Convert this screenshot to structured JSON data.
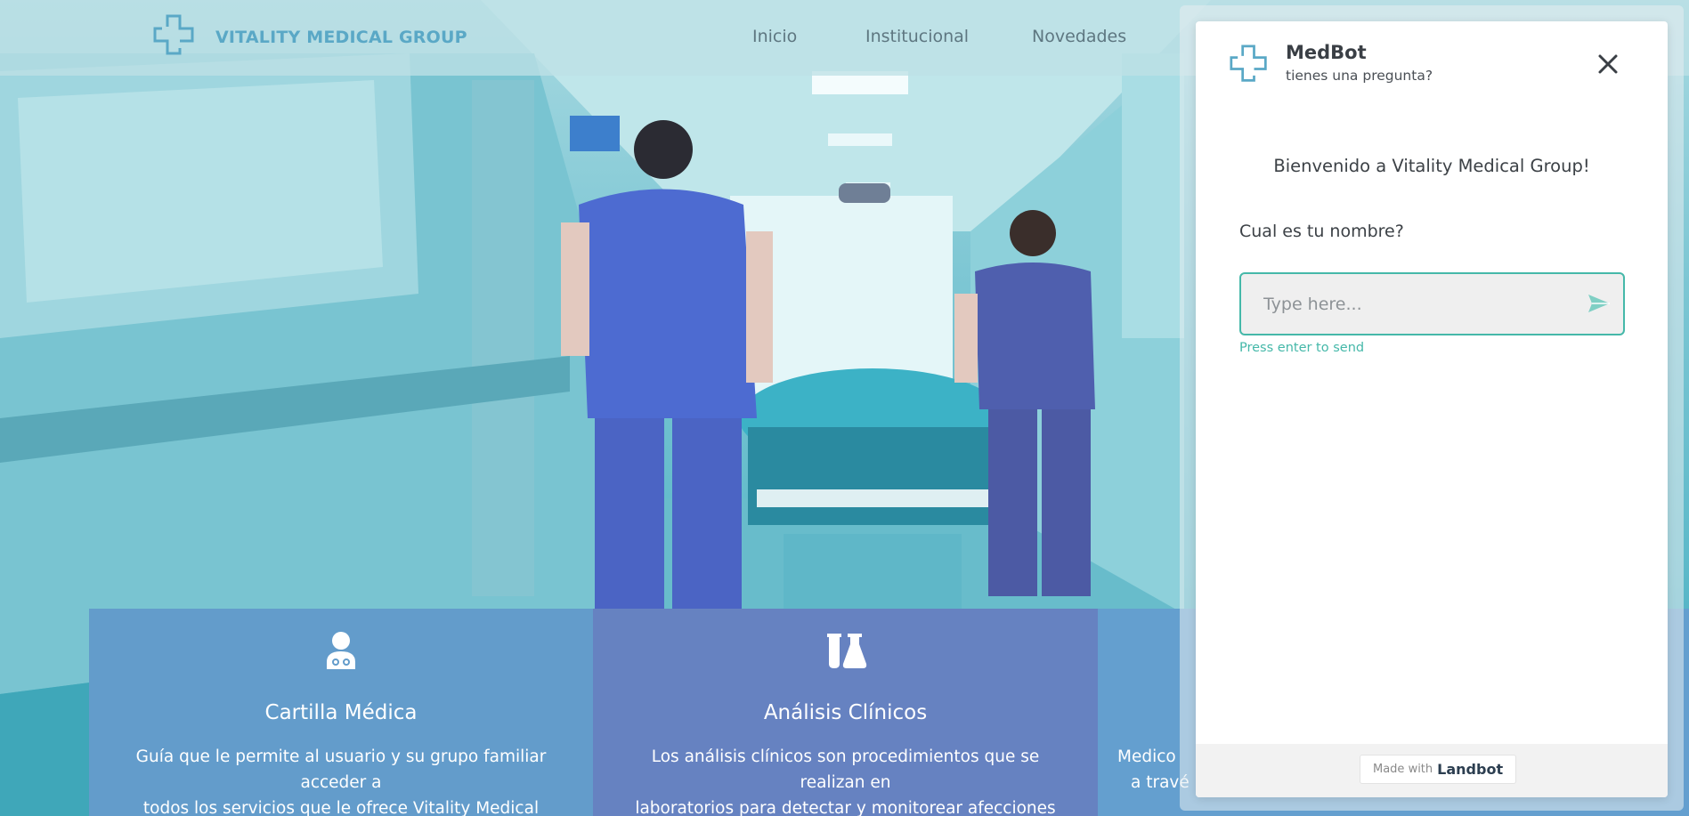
{
  "brand": {
    "name": "VITALITY MEDICAL GROUP",
    "logo_icon": "medical-cross-outline-icon"
  },
  "nav": {
    "links": [
      "Inicio",
      "Institucional",
      "Novedades"
    ]
  },
  "cards": [
    {
      "icon": "doctor-icon",
      "title": "Cartilla Médica",
      "desc_line1": "Guía que le permite al usuario y su grupo familiar acceder a",
      "desc_line2": "todos los servicios que le ofrece Vitality Medical Group."
    },
    {
      "icon": "lab-flasks-icon",
      "title": "Análisis Clínicos",
      "desc_line1": "Los análisis clínicos son procedimientos que se realizan en",
      "desc_line2": "laboratorios para detectar y monitorear afecciones médicas."
    },
    {
      "title": "",
      "desc_line1": "Medico",
      "desc_line2": "a travé"
    }
  ],
  "chat": {
    "title": "MedBot",
    "subtitle": "tienes una pregunta?",
    "welcome": "Bienvenido a Vitality Medical Group!",
    "question": "Cual es tu nombre?",
    "input_placeholder": "Type here...",
    "hint": "Press enter to send",
    "footer_made_with": "Made with",
    "footer_brand": "Landbot",
    "close_icon": "close-icon",
    "send_icon": "send-icon"
  },
  "colors": {
    "accent": "#45b8a9",
    "brand_blue": "#5aa8c6",
    "card1": "#639ccb",
    "card2": "#6682c1",
    "card3": "#649fcf"
  }
}
